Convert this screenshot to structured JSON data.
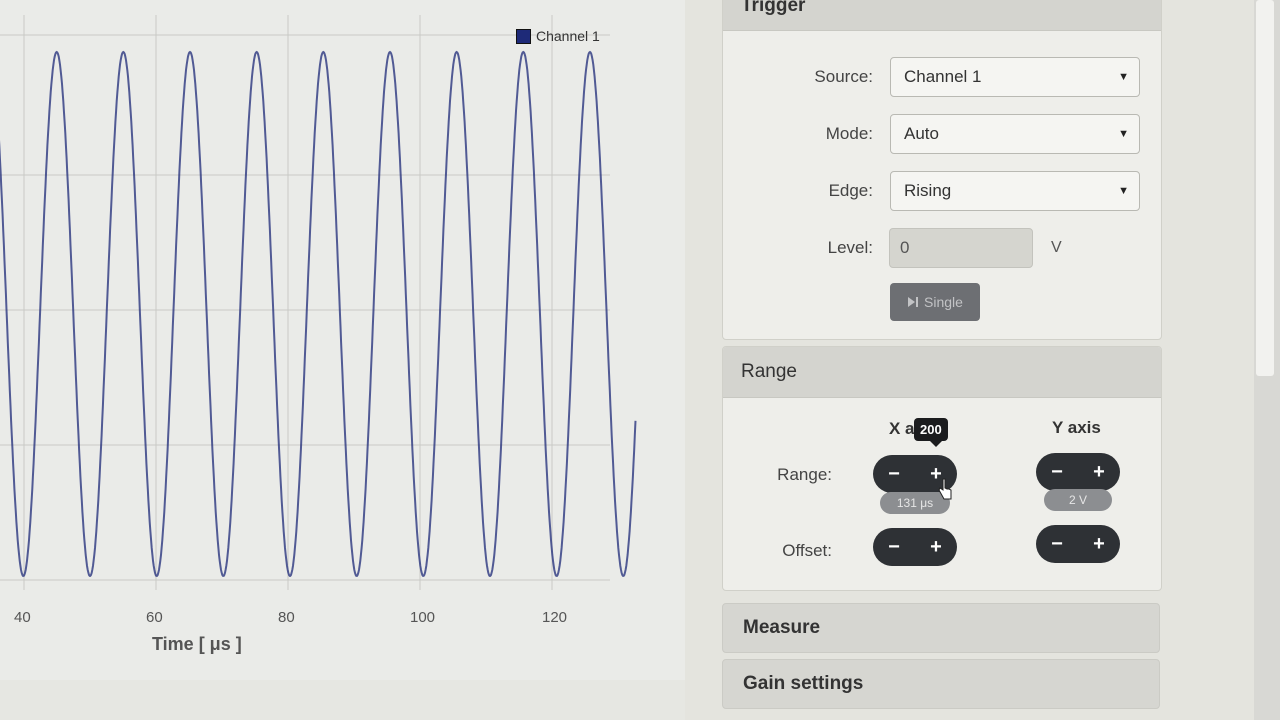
{
  "chart_data": {
    "type": "line",
    "xlabel": "Time [ μs ]",
    "ylabel": "",
    "x_ticks": [
      40,
      60,
      80,
      100,
      120
    ],
    "xlim": [
      35,
      135
    ],
    "series": [
      {
        "name": "Channel 1",
        "color": "#1e2a78",
        "period_us": 10.1,
        "x_end": 132.5,
        "amplitude": 1.0,
        "offset": 0.0
      }
    ],
    "grid": true,
    "legend": "top-right"
  },
  "trigger": {
    "title": "Trigger",
    "source_label": "Source:",
    "source_value": "Channel 1",
    "mode_label": "Mode:",
    "mode_value": "Auto",
    "edge_label": "Edge:",
    "edge_value": "Rising",
    "level_label": "Level:",
    "level_value": "0",
    "level_unit": "V",
    "single_label": "Single"
  },
  "range": {
    "title": "Range",
    "x_axis_label": "X a",
    "y_axis_label": "Y axis",
    "range_label": "Range:",
    "offset_label": "Offset:",
    "x_range_value": "131 μs",
    "y_range_value": "2 V",
    "tooltip": "200",
    "minus": "−",
    "plus": "+"
  },
  "measure": {
    "title": "Measure"
  },
  "gain": {
    "title": "Gain settings"
  }
}
